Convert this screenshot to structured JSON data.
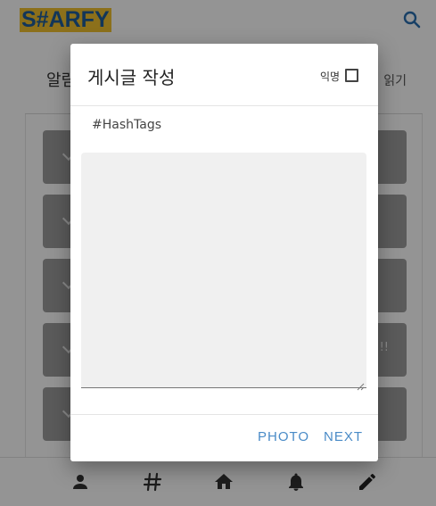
{
  "app": {
    "logo_text": "S#ARFY"
  },
  "background": {
    "notice_title": "알림",
    "notice_read": "읽기",
    "items": [
      {
        "tail": ""
      },
      {
        "tail": ""
      },
      {
        "tail": ""
      },
      {
        "tail": "!!"
      },
      {
        "tail": ""
      }
    ]
  },
  "dialog": {
    "title": "게시글 작성",
    "anonymous_label": "익명",
    "anonymous_checked": false,
    "hashtag_placeholder": "#HashTags",
    "content_value": "",
    "photo_label": "PHOTO",
    "next_label": "NEXT"
  },
  "nav": {
    "items": [
      "person-icon",
      "hashtag-icon",
      "home-icon",
      "bell-icon",
      "pencil-icon"
    ]
  },
  "colors": {
    "accent": "#4a8bc7",
    "logo_bg": "#f2c230",
    "logo_text": "#1f5e9a",
    "overlay": "rgba(0,0,0,0.42)"
  }
}
